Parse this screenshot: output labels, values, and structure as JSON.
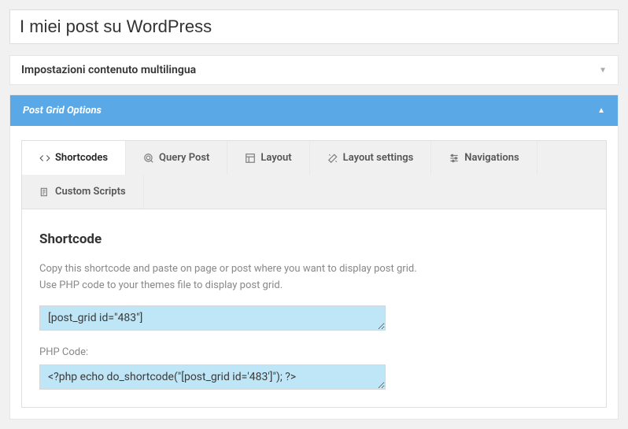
{
  "title": "I miei post su WordPress",
  "metabox_multilang": {
    "title": "Impostazioni contenuto multilingua"
  },
  "pg": {
    "title": "Post Grid Options",
    "tabs": {
      "shortcodes": "Shortcodes",
      "query": "Query Post",
      "layout": "Layout",
      "layout_settings": "Layout settings",
      "navigations": "Navigations",
      "custom_scripts": "Custom Scripts"
    },
    "content": {
      "heading": "Shortcode",
      "desc_line1": "Copy this shortcode and paste on page or post where you want to display post grid.",
      "desc_line2": "Use PHP code to your themes file to display post grid.",
      "shortcode_value": "[post_grid id=\"483\"]",
      "php_label": "PHP Code:",
      "php_value": "<?php echo do_shortcode(\"[post_grid id='483']\"); ?>"
    }
  }
}
